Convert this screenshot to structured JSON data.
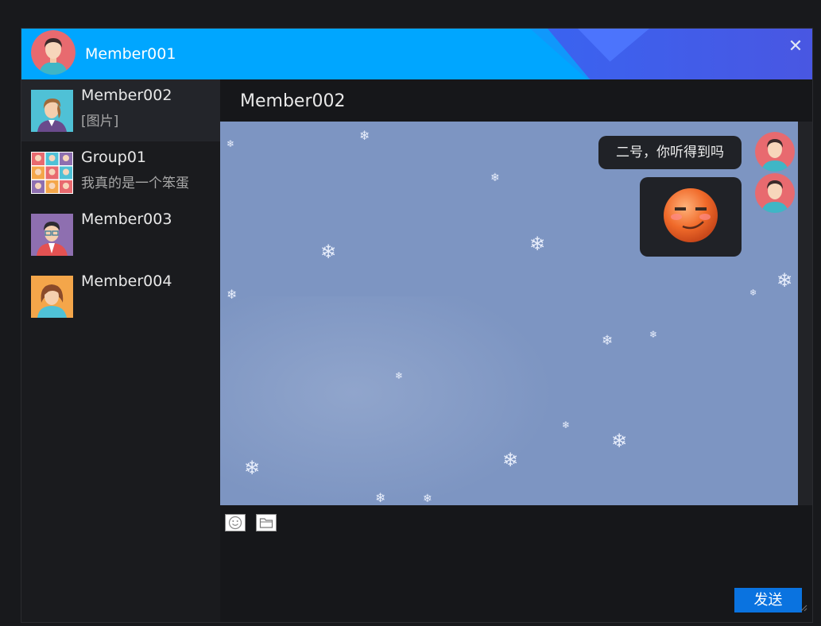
{
  "window": {
    "user_name": "Member001",
    "close_label": "✕"
  },
  "contacts": [
    {
      "name": "Member002",
      "preview": "[图片]",
      "active": true
    },
    {
      "name": "Group01",
      "preview": "我真的是一个笨蛋",
      "active": false
    },
    {
      "name": "Member003",
      "preview": "",
      "active": false
    },
    {
      "name": "Member004",
      "preview": "",
      "active": false
    }
  ],
  "chat": {
    "title": "Member002",
    "messages": [
      {
        "type": "text",
        "text": "二号，你听得到吗",
        "from": "Member001"
      },
      {
        "type": "emoji",
        "emoji": "smirk-face-icon",
        "from": "Member001"
      }
    ]
  },
  "composer": {
    "send_label": "发送",
    "tools": [
      "smiley-icon",
      "folder-icon"
    ]
  },
  "colors": {
    "titlebar": "#00a6ff",
    "chat_background": "#7d95c2",
    "send_button": "#0a73e0"
  }
}
